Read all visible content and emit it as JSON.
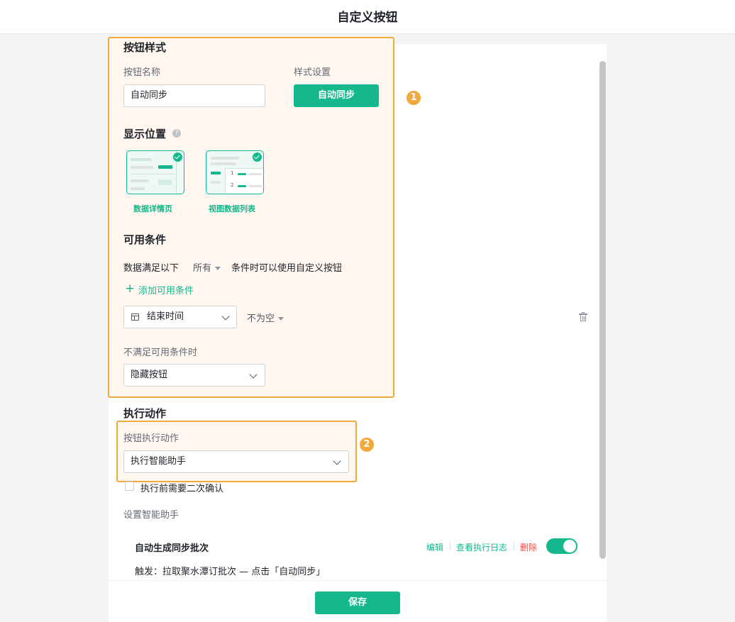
{
  "header": {
    "title": "自定义按钮"
  },
  "button_style": {
    "section_title": "按钮样式",
    "name_label": "按钮名称",
    "name_value": "自动同步",
    "style_label": "样式设置",
    "preview_label": "自动同步"
  },
  "display_position": {
    "title": "显示位置",
    "options": [
      {
        "label": "数据详情页",
        "checked": true
      },
      {
        "label": "视图数据列表",
        "checked": true
      }
    ],
    "list_numbers": [
      "1",
      "2"
    ]
  },
  "conditions": {
    "title": "可用条件",
    "rule_prefix": "数据满足以下",
    "rule_mode": "所有",
    "rule_suffix": "条件时可以使用自定义按钮",
    "add_label": "添加可用条件",
    "field_value": "结束时间",
    "operator_value": "不为空",
    "unmet_label": "不满足可用条件时",
    "unmet_value": "隐藏按钮"
  },
  "action": {
    "section_title": "执行动作",
    "action_label": "按钮执行动作",
    "action_value": "执行智能助手",
    "confirm_label": "执行前需要二次确认",
    "confirm_checked": false,
    "assistant_label": "设置智能助手",
    "assistant": {
      "name": "自动生成同步批次",
      "edit": "编辑",
      "log": "查看执行日志",
      "delete": "删除",
      "enabled": true,
      "trigger": "触发：拉取聚水潭订批次 — 点击「自动同步」"
    }
  },
  "annotations": [
    "1",
    "2"
  ],
  "footer": {
    "save_label": "保存"
  },
  "colors": {
    "accent": "#14b88c",
    "highlight": "#f2a93b",
    "danger": "#f54a45"
  }
}
